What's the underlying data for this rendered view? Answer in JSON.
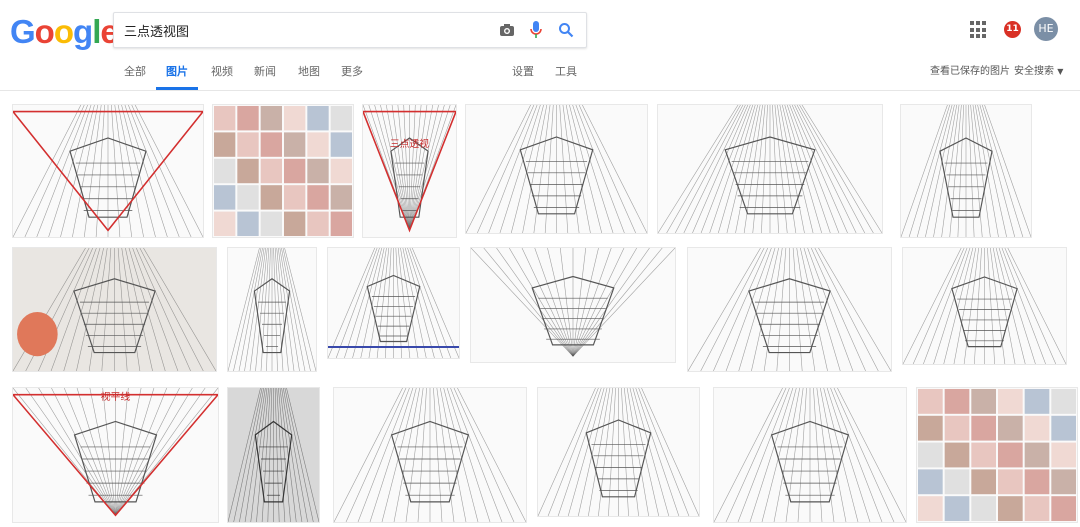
{
  "logo": {
    "letters": [
      "G",
      "o",
      "o",
      "g",
      "l",
      "e"
    ],
    "colors": [
      "#4285F4",
      "#EA4335",
      "#FBBC05",
      "#4285F4",
      "#34A853",
      "#EA4335"
    ]
  },
  "search": {
    "query": "三点透视图",
    "camera_icon": "camera-icon",
    "mic_icon": "mic-icon",
    "search_icon": "search-icon"
  },
  "tabs": [
    {
      "label": "全部",
      "active": false
    },
    {
      "label": "图片",
      "active": true
    },
    {
      "label": "视频",
      "active": false
    },
    {
      "label": "新闻",
      "active": false
    },
    {
      "label": "地图",
      "active": false
    },
    {
      "label": "更多",
      "active": false
    }
  ],
  "tools": {
    "settings": "设置",
    "tools": "工具"
  },
  "header_right": {
    "saved_images": "查看已保存的图片",
    "safe_search": "安全搜索",
    "notification_count": "11",
    "avatar_initials": "HE"
  },
  "accent_color": "#1a73e8",
  "thumbnails": [
    {
      "row": 0,
      "kind": "sketch-red"
    },
    {
      "row": 0,
      "kind": "collage"
    },
    {
      "row": 0,
      "kind": "diagram-red",
      "caption": "三点透视"
    },
    {
      "row": 0,
      "kind": "sketch"
    },
    {
      "row": 0,
      "kind": "sketch-dense"
    },
    {
      "row": 0,
      "kind": "sketch"
    },
    {
      "row": 1,
      "kind": "photo-tower"
    },
    {
      "row": 1,
      "kind": "sketch"
    },
    {
      "row": 1,
      "kind": "sketch-blue"
    },
    {
      "row": 1,
      "kind": "diagram"
    },
    {
      "row": 1,
      "kind": "sketch"
    },
    {
      "row": 1,
      "kind": "sketch"
    },
    {
      "row": 2,
      "kind": "diagram-red",
      "caption": "视平线"
    },
    {
      "row": 2,
      "kind": "sketch-dark"
    },
    {
      "row": 2,
      "kind": "sketch"
    },
    {
      "row": 2,
      "kind": "sketch"
    },
    {
      "row": 2,
      "kind": "sketch"
    },
    {
      "row": 2,
      "kind": "collage"
    }
  ]
}
